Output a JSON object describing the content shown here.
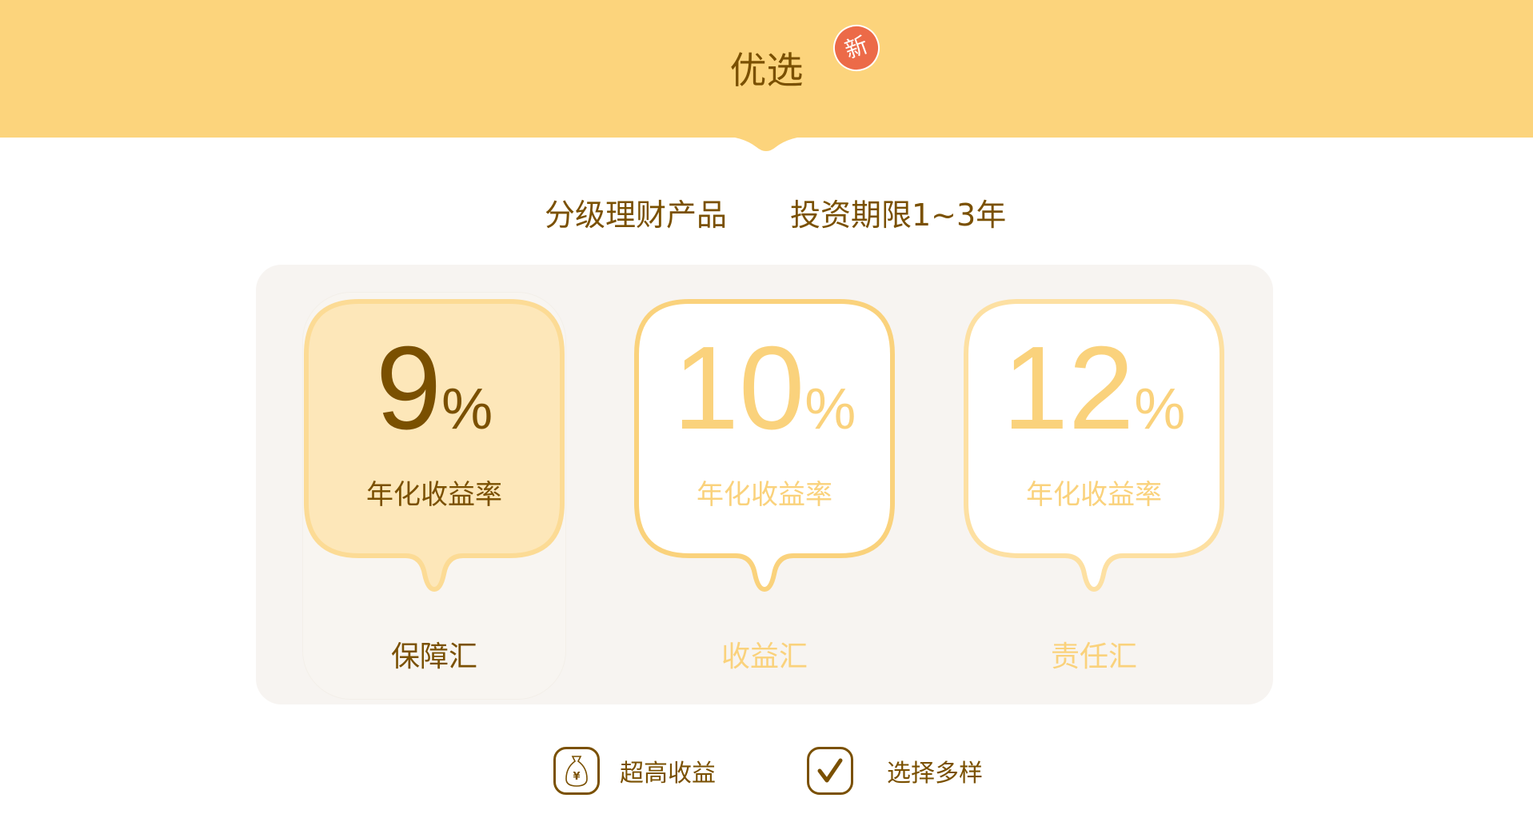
{
  "header": {
    "title": "优选",
    "badge": "新"
  },
  "subtitle": {
    "left": "分级理财产品",
    "right": "投资期限1~3年"
  },
  "cards": [
    {
      "rate": "9",
      "unit": "%",
      "label": "年化收益率",
      "name": "保障汇",
      "selected": true
    },
    {
      "rate": "10",
      "unit": "%",
      "label": "年化收益率",
      "name": "收益汇",
      "selected": false
    },
    {
      "rate": "12",
      "unit": "%",
      "label": "年化收益率",
      "name": "责任汇",
      "selected": false
    }
  ],
  "features": [
    {
      "icon": "money-bag-icon",
      "label": "超高收益"
    },
    {
      "icon": "checkmark-icon",
      "label": "选择多样"
    }
  ],
  "colors": {
    "header": "#fcd47c",
    "brown": "#7a5000",
    "light": "#fad27c",
    "badge": "#ec6a48",
    "panel": "#f7f4f1"
  }
}
